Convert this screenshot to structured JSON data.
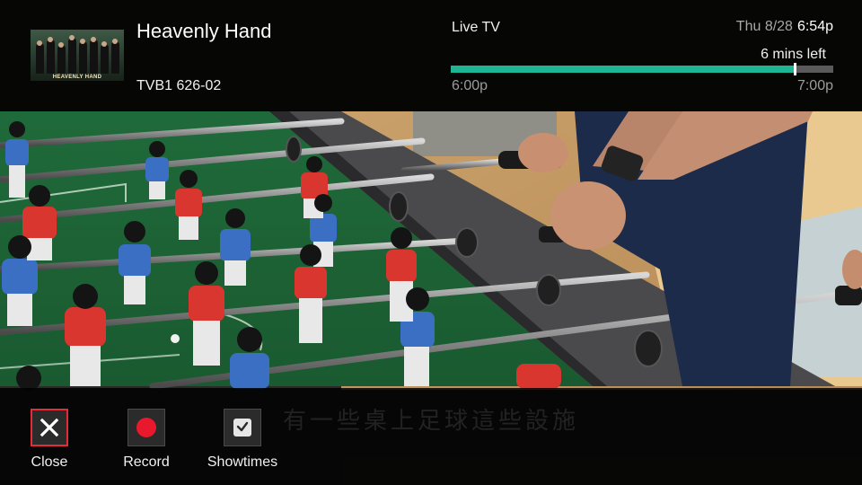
{
  "program": {
    "title": "Heavenly Hand",
    "channel": "TVB1 626-02",
    "thumbnail_text": "HEAVENLY HAND"
  },
  "status": {
    "label": "Live TV",
    "date": "Thu 8/28",
    "time": "6:54p",
    "remaining": "6 mins left",
    "start": "6:00p",
    "end": "7:00p",
    "progress_fraction": 0.9
  },
  "subtitle_text": "有一些桌上足球這些設施",
  "actions": [
    {
      "label": "Close",
      "icon": "close-icon",
      "selected": true
    },
    {
      "label": "Record",
      "icon": "record-icon",
      "selected": false
    },
    {
      "label": "Showtimes",
      "icon": "clock-icon",
      "selected": false
    }
  ],
  "colors": {
    "progress": "#1db593",
    "selection": "#e52b35",
    "record": "#e8192c"
  }
}
